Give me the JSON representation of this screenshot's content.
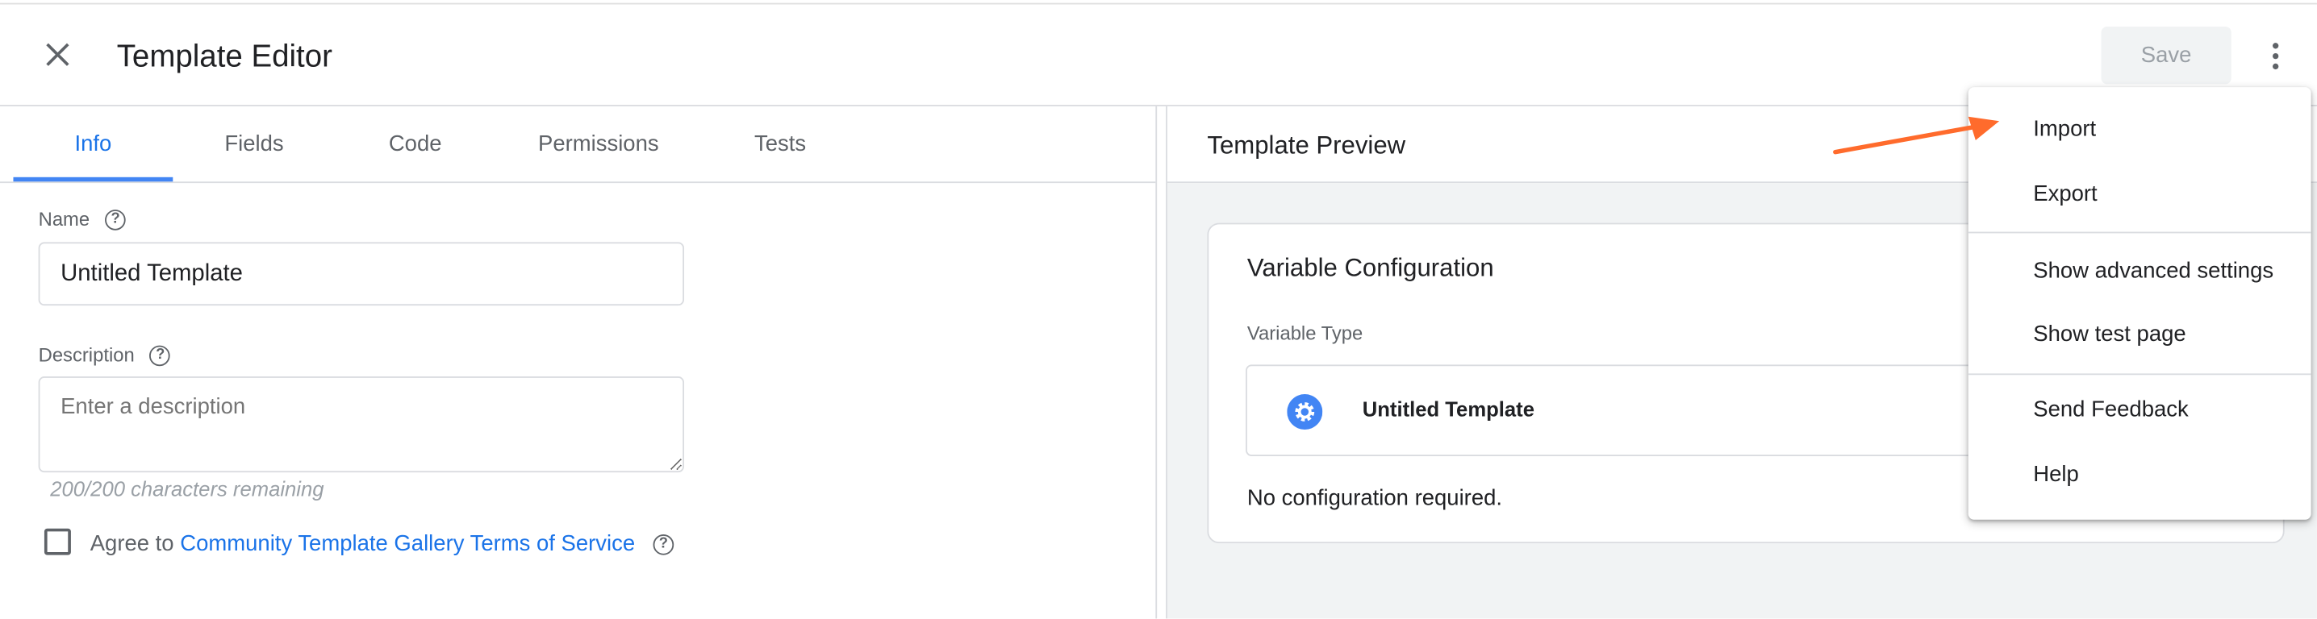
{
  "header": {
    "title": "Template Editor",
    "save_label": "Save",
    "close_icon": "close-icon",
    "more_icon": "more-vert-icon"
  },
  "tabs": [
    {
      "label": "Info",
      "active": true
    },
    {
      "label": "Fields"
    },
    {
      "label": "Code"
    },
    {
      "label": "Permissions"
    },
    {
      "label": "Tests"
    }
  ],
  "info": {
    "name_label": "Name",
    "name_value": "Untitled Template",
    "description_label": "Description",
    "description_placeholder": "Enter a description",
    "chars_remaining": "200/200 characters remaining",
    "agree_prefix": "Agree to",
    "agree_link": "Community Template Gallery Terms of Service",
    "agree_checked": false
  },
  "preview": {
    "title": "Template Preview",
    "card_title": "Variable Configuration",
    "variable_type_label": "Variable Type",
    "variable_type_value": "Untitled Template",
    "no_config": "No configuration required."
  },
  "menu": {
    "items": [
      {
        "label": "Import"
      },
      {
        "label": "Export"
      },
      {
        "label": "Show advanced settings"
      },
      {
        "label": "Show test page"
      },
      {
        "label": "Send Feedback"
      },
      {
        "label": "Help"
      }
    ]
  },
  "colors": {
    "accent": "#1a73e8",
    "tab_indicator": "#4285f4",
    "arrow": "#ff6b2c",
    "preview_bg": "#f1f3f4"
  }
}
